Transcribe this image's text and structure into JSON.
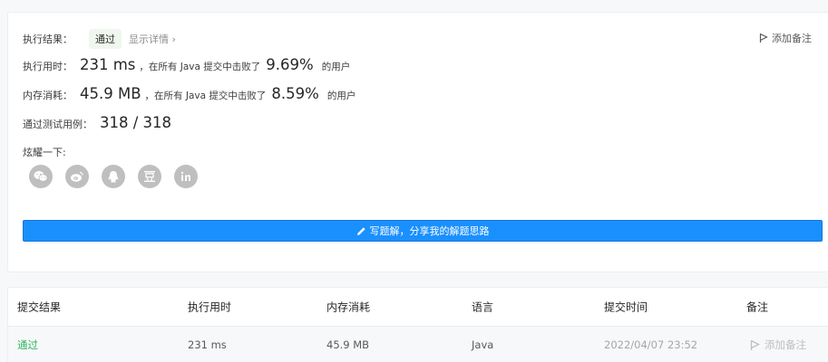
{
  "result": {
    "label": "执行结果：",
    "status": "通过",
    "detail_link": "显示详情 ›",
    "add_note": "添加备注"
  },
  "runtime": {
    "label": "执行用时：",
    "value": "231 ms",
    "prefix": "，在所有 Java 提交中击败了",
    "percent": "9.69%",
    "suffix": "的用户"
  },
  "memory": {
    "label": "内存消耗：",
    "value": "45.9 MB",
    "prefix": "，在所有 Java 提交中击败了",
    "percent": "8.59%",
    "suffix": "的用户"
  },
  "testcases": {
    "label": "通过测试用例：",
    "value": "318 / 318"
  },
  "share": {
    "label": "炫耀一下:",
    "icons": [
      "wechat-icon",
      "weibo-icon",
      "qq-icon",
      "douban-icon",
      "linkedin-icon"
    ]
  },
  "write_button": "写题解，分享我的解题思路",
  "table": {
    "headers": [
      "提交结果",
      "执行用时",
      "内存消耗",
      "语言",
      "提交时间",
      "备注"
    ],
    "row": {
      "status": "通过",
      "runtime": "231 ms",
      "memory": "45.9 MB",
      "language": "Java",
      "time": "2022/04/07 23:52",
      "note": "添加备注"
    }
  },
  "colors": {
    "accent": "#1a90ff",
    "pass": "#2db55d",
    "icon_gray": "#bfbfbf"
  }
}
